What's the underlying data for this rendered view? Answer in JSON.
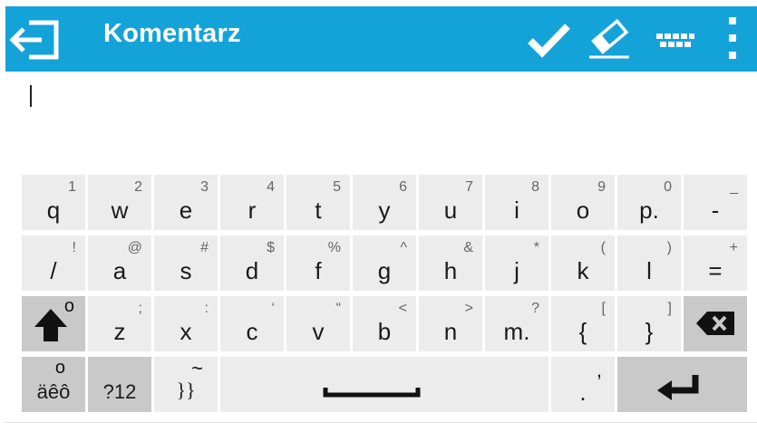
{
  "appbar": {
    "title": "Komentarz",
    "background": "#14a3d9",
    "icons": [
      "exit-icon",
      "check-icon",
      "eraser-icon",
      "keyboard-icon",
      "more-vertical-icon"
    ]
  },
  "editor": {
    "value": ""
  },
  "keyboard": {
    "row1": [
      {
        "key": "q",
        "hint": "1"
      },
      {
        "key": "w",
        "hint": "2"
      },
      {
        "key": "e",
        "hint": "3"
      },
      {
        "key": "r",
        "hint": "4"
      },
      {
        "key": "t",
        "hint": "5"
      },
      {
        "key": "y",
        "hint": "6"
      },
      {
        "key": "u",
        "hint": "7"
      },
      {
        "key": "i",
        "hint": "8"
      },
      {
        "key": "o",
        "hint": "9"
      },
      {
        "key": "p.",
        "hint": "0"
      },
      {
        "key": "-",
        "hint": "_"
      }
    ],
    "row2": [
      {
        "key": "/",
        "hint": "!"
      },
      {
        "key": "a",
        "hint": "@"
      },
      {
        "key": "s",
        "hint": "#"
      },
      {
        "key": "d",
        "hint": "$"
      },
      {
        "key": "f",
        "hint": "%"
      },
      {
        "key": "g",
        "hint": "^"
      },
      {
        "key": "h",
        "hint": "&"
      },
      {
        "key": "j",
        "hint": "*"
      },
      {
        "key": "k",
        "hint": "("
      },
      {
        "key": "l",
        "hint": ")"
      },
      {
        "key": "=",
        "hint": "+"
      }
    ],
    "row3": [
      {
        "key": "z",
        "hint": ";"
      },
      {
        "key": "x",
        "hint": ":"
      },
      {
        "key": "c",
        "hint": "‘"
      },
      {
        "key": "v",
        "hint": "“"
      },
      {
        "key": "b",
        "hint": "<"
      },
      {
        "key": "n",
        "hint": ">"
      },
      {
        "key": "m.",
        "hint": "?"
      },
      {
        "key": "{",
        "hint": "["
      },
      {
        "key": "}",
        "hint": "]"
      }
    ],
    "row4": {
      "accents": "äêô",
      "accents_hint": "o",
      "symbols": "?12",
      "braces": "}}",
      "braces_hint": "~",
      "period": ".",
      "period_hint": ","
    },
    "shift_hint": "o",
    "key_color": "#ececec",
    "dark_key_color": "#c9c9c9"
  }
}
